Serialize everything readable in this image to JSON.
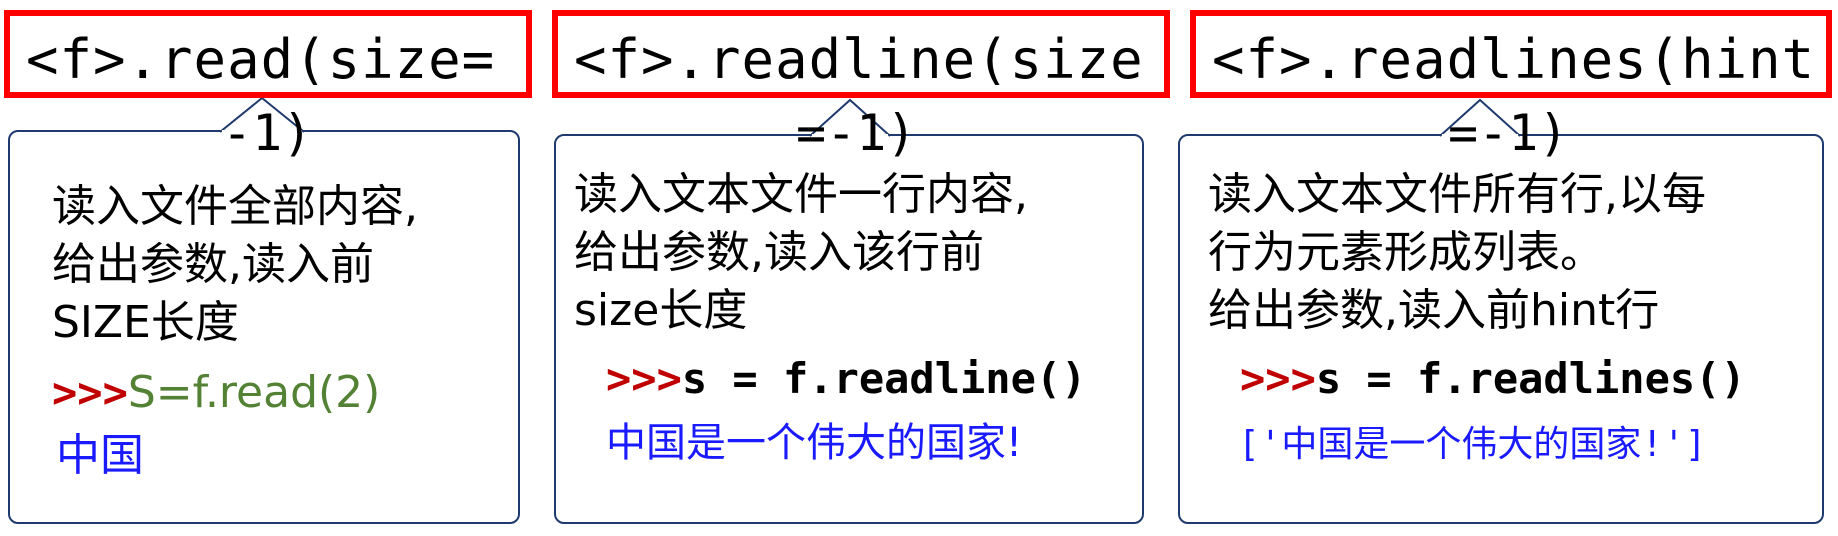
{
  "cards": [
    {
      "title": "<f>.read(size=",
      "title_cont": "-1)",
      "description": [
        "读入文件全部内容,",
        "给出参数,读入前",
        "SIZE长度"
      ],
      "prompt": ">>>",
      "code": "S=f.read(2)",
      "output": "中国"
    },
    {
      "title": "<f>.readline(size",
      "title_cont": "=-1)",
      "description": [
        "读入文本文件一行内容,",
        "给出参数,读入该行前",
        "size长度"
      ],
      "prompt": ">>>",
      "code": "s = f.readline()",
      "output": "中国是一个伟大的国家!"
    },
    {
      "title": "<f>.readlines(hint",
      "title_cont": "=-1)",
      "description": [
        "读入文本文件所有行,以每",
        "行为元素形成列表。",
        "给出参数,读入前hint行"
      ],
      "prompt": ">>>",
      "code": "s = f.readlines()",
      "output": "['中国是一个伟大的国家!']"
    }
  ],
  "colors": {
    "title_border": "#ff0000",
    "callout_border": "#1f3a6e",
    "prompt": "#c00000",
    "code_green": "#548235",
    "output_blue": "#1a1aff"
  }
}
